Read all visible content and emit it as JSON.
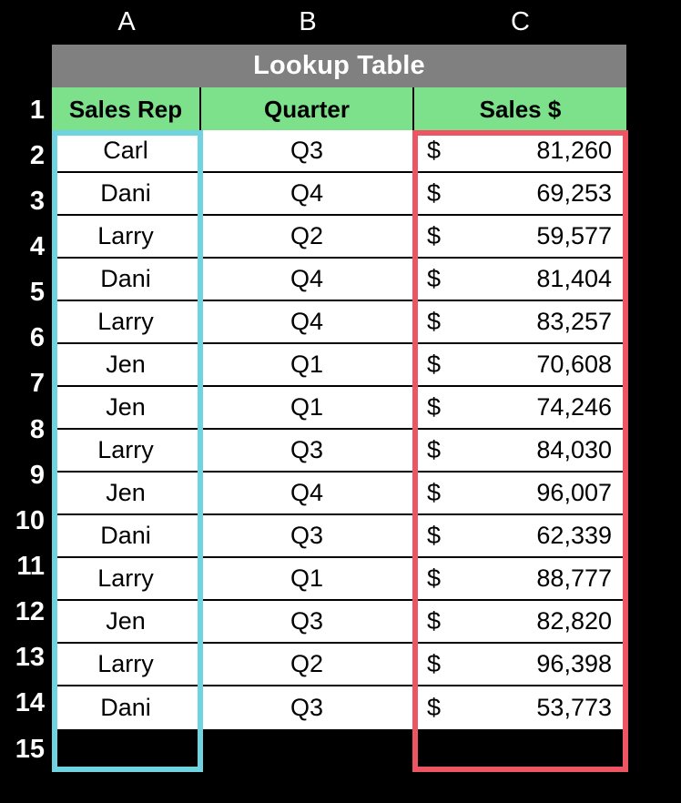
{
  "spreadsheet": {
    "column_letters": [
      "A",
      "B",
      "C"
    ],
    "row_numbers": [
      "1",
      "2",
      "3",
      "4",
      "5",
      "6",
      "7",
      "8",
      "9",
      "10",
      "11",
      "12",
      "13",
      "14",
      "15"
    ],
    "title": "Lookup Table",
    "title_bg": "#808080",
    "header_bg": "#7DE08A",
    "headers": [
      "Sales Rep",
      "Quarter",
      "Sales $"
    ],
    "currency_symbol": "$",
    "highlight_cyan": "#6FD3E0",
    "highlight_red": "#EE5562",
    "rows": [
      {
        "row": "2",
        "sales_rep": "Carl",
        "quarter": "Q3",
        "sales": "81,260"
      },
      {
        "row": "3",
        "sales_rep": "Dani",
        "quarter": "Q4",
        "sales": "69,253"
      },
      {
        "row": "4",
        "sales_rep": "Larry",
        "quarter": "Q2",
        "sales": "59,577"
      },
      {
        "row": "5",
        "sales_rep": "Dani",
        "quarter": "Q4",
        "sales": "81,404"
      },
      {
        "row": "6",
        "sales_rep": "Larry",
        "quarter": "Q4",
        "sales": "83,257"
      },
      {
        "row": "7",
        "sales_rep": "Jen",
        "quarter": "Q1",
        "sales": "70,608"
      },
      {
        "row": "8",
        "sales_rep": "Jen",
        "quarter": "Q1",
        "sales": "74,246"
      },
      {
        "row": "9",
        "sales_rep": "Larry",
        "quarter": "Q3",
        "sales": "84,030"
      },
      {
        "row": "10",
        "sales_rep": "Jen",
        "quarter": "Q4",
        "sales": "96,007"
      },
      {
        "row": "11",
        "sales_rep": "Dani",
        "quarter": "Q3",
        "sales": "62,339"
      },
      {
        "row": "12",
        "sales_rep": "Larry",
        "quarter": "Q1",
        "sales": "88,777"
      },
      {
        "row": "13",
        "sales_rep": "Jen",
        "quarter": "Q3",
        "sales": "82,820"
      },
      {
        "row": "14",
        "sales_rep": "Larry",
        "quarter": "Q2",
        "sales": "96,398"
      },
      {
        "row": "15",
        "sales_rep": "Dani",
        "quarter": "Q3",
        "sales": "53,773"
      }
    ]
  }
}
